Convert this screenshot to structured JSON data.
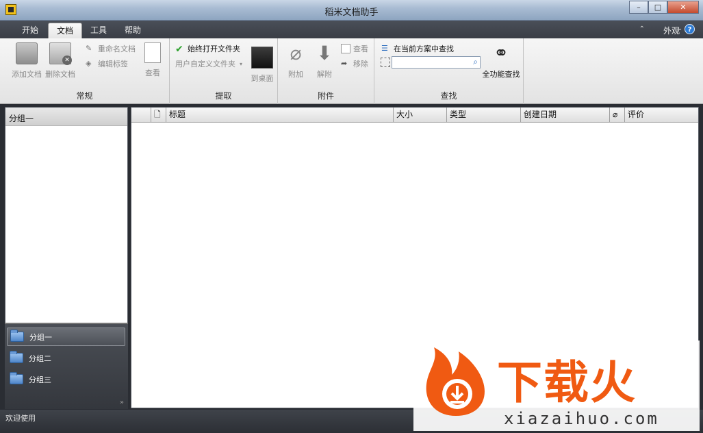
{
  "window": {
    "title": "稻米文档助手",
    "minimize": "–",
    "maximize": "□",
    "close": "✕"
  },
  "tabs": [
    {
      "label": "开始",
      "active": false
    },
    {
      "label": "文档",
      "active": true
    },
    {
      "label": "工具",
      "active": false
    },
    {
      "label": "帮助",
      "active": false
    }
  ],
  "ribbon_right": {
    "collapse_caret": "⌃",
    "appearance": "外观",
    "appearance_caret": "⌄",
    "help": "?"
  },
  "groups": {
    "regular": {
      "label": "常规",
      "add_doc": "添加文档",
      "delete_doc": "删除文档",
      "rename_doc": "重命名文档",
      "edit_tags": "编辑标签",
      "view": "查看"
    },
    "extract": {
      "label": "提取",
      "always_open_folder": "始终打开文件夹",
      "user_folder": "用户自定义文件夹",
      "to_desktop": "到桌面"
    },
    "attachment": {
      "label": "附件",
      "attach": "附加",
      "detach": "解附",
      "view": "查看",
      "remove": "移除"
    },
    "search": {
      "label": "查找",
      "in_current_scheme": "在当前方案中查找",
      "search_value": "",
      "search_placeholder": "",
      "full_search": "全功能查找"
    }
  },
  "left_panel": {
    "header": "分组一",
    "nav": [
      {
        "label": "分组一",
        "active": true
      },
      {
        "label": "分组二",
        "active": false
      },
      {
        "label": "分组三",
        "active": false
      }
    ],
    "more": "»"
  },
  "table": {
    "columns": [
      "标题",
      "大小",
      "类型",
      "创建日期",
      "评价"
    ],
    "rows": []
  },
  "status": {
    "text": "欢迎使用"
  },
  "watermark": {
    "brand": "下载火",
    "url": "xiazaihuo.com"
  },
  "colors": {
    "accent": "#f05a12",
    "check": "#2aa02a",
    "link_blue": "#2e6fbf"
  }
}
